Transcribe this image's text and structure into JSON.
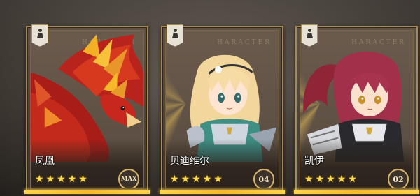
{
  "watermark": "HARACTER",
  "cards": [
    {
      "name": "凤凰",
      "stars": 5,
      "level": "MAX",
      "art": "phoenix",
      "accent": "#c8271e"
    },
    {
      "name": "贝迪维尔",
      "stars": 5,
      "level": "04",
      "art": "knight-girl-blonde",
      "accent": "#f2d69b"
    },
    {
      "name": "凯伊",
      "stars": 5,
      "level": "02",
      "art": "knight-girl-red",
      "accent": "#8f2537"
    }
  ],
  "colors": {
    "frame": "#a58a55",
    "star": "#ffd84a",
    "bar": "#ffd34a"
  }
}
